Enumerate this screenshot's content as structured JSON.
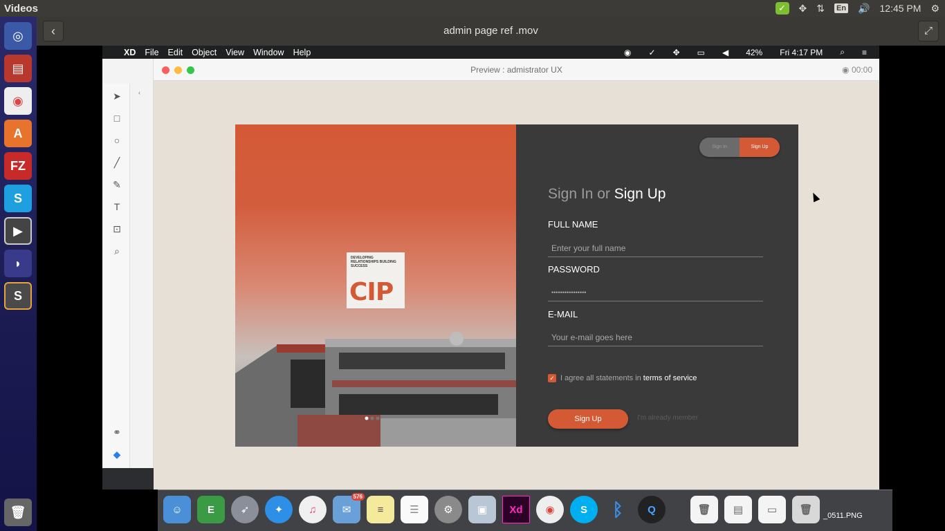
{
  "topbar": {
    "app_name": "Videos",
    "time": "12:45 PM",
    "lang": "En"
  },
  "header": {
    "title": "admin page ref .mov"
  },
  "mac": {
    "menu": [
      "XD",
      "File",
      "Edit",
      "Object",
      "View",
      "Window",
      "Help"
    ],
    "battery": "42%",
    "clock": "Fri 4:17 PM"
  },
  "preview": {
    "title": "Preview : admistrator UX",
    "timer": "00:00"
  },
  "card": {
    "logo_tagline": "DEVELOPING RELATIONSHIPS BUILDING SUCCESS",
    "logo_text": "CIP",
    "toggle_signin": "Sign In",
    "toggle_signup": "Sign Up",
    "heading_muted": "Sign In or",
    "heading_strong": "Sign Up",
    "fullname_label": "FULL NAME",
    "fullname_placeholder": "Enter your full name",
    "password_label": "PASSWORD",
    "password_value": "••••••••••••••••",
    "email_label": "E-MAIL",
    "email_placeholder": "Your e-mail goes here",
    "agree_text": "I agree all statements in",
    "agree_link": "terms of service",
    "signup_button": "Sign Up",
    "already_member": "I'm already member"
  },
  "dock": {
    "mail_badge": "576",
    "file_label": "_0511.PNG"
  }
}
